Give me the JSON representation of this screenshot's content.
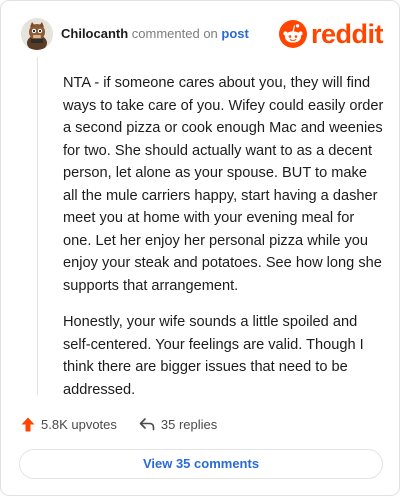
{
  "comment": {
    "username": "Chilocanth",
    "action_text": "commented on",
    "post_link": "post",
    "paragraphs": [
      "NTA - if someone cares about you, they will find ways to take care of you. Wifey could easily order a second pizza or cook enough Mac and weenies for two. She should actually want to as a decent person, let alone as your spouse. BUT to make all the mule carriers happy, start having a dasher meet you at home with your evening meal for one. Let her enjoy her personal pizza while you enjoy your steak and potatoes. See how long she supports that arrangement.",
      "Honestly, your wife sounds a little spoiled and self-centered. Your feelings are valid. Though I think there are bigger issues that need to be addressed."
    ]
  },
  "brand": {
    "wordmark": "reddit",
    "color": "#ff4500"
  },
  "actions": {
    "upvotes": "5.8K upvotes",
    "replies": "35 replies"
  },
  "view_button": "View 35 comments",
  "icons": {
    "upvote": "upvote-arrow-icon",
    "reply": "reply-arrow-icon",
    "logo": "reddit-snoo-icon"
  }
}
